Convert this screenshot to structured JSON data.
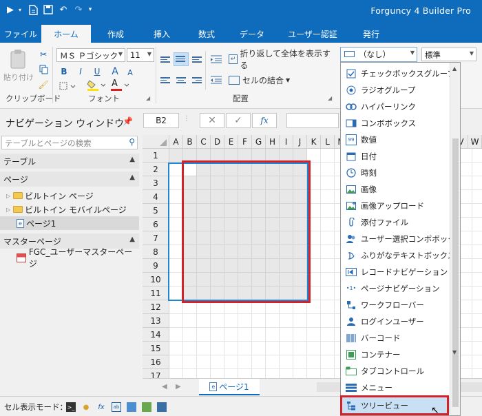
{
  "title_bar": {
    "app_title": "Forguncy 4 Builder Pro"
  },
  "ribbon_tabs": [
    "ファイル",
    "ホーム",
    "作成",
    "挿入",
    "数式",
    "データ",
    "ユーザー認証",
    "発行"
  ],
  "active_tab": "ホーム",
  "ribbon": {
    "paste_label": "貼り付け",
    "clipboard_group": "クリップボード",
    "font_group": "フォント",
    "alignment_group": "配置",
    "font_name": "ＭＳ Ｐゴシック",
    "font_size": "11",
    "wrap_text": "折り返して全体を表示する",
    "merge_cells": "セルの結合",
    "cell_type_combo": "（なし）",
    "style_combo": "標準",
    "bold": "B",
    "italic": "I",
    "underline": "U",
    "grow_font": "A",
    "shrink_font": "A",
    "font_color_letter": "A"
  },
  "navigation": {
    "title": "ナビゲーション ウィンドウ",
    "search_placeholder": "テーブルとページの検索",
    "sections": {
      "tables": "テーブル",
      "pages": "ページ",
      "master_pages": "マスターページ"
    },
    "page_items": [
      "ビルトイン ページ",
      "ビルトイン モバイルページ",
      "ページ1"
    ],
    "master_items": [
      "FGC_ユーザーマスターページ"
    ]
  },
  "formula_bar": {
    "name_box": "B2",
    "cancel": "✕",
    "confirm": "✓",
    "fx": "fx"
  },
  "grid": {
    "columns": [
      "A",
      "B",
      "C",
      "D",
      "E",
      "F",
      "G",
      "H",
      "I",
      "J",
      "K",
      "L",
      "M"
    ],
    "right_columns": [
      "V",
      "W"
    ],
    "rows": [
      "1",
      "2",
      "3",
      "4",
      "5",
      "6",
      "7",
      "8",
      "9",
      "10",
      "11",
      "12",
      "13",
      "14",
      "15",
      "16",
      "17"
    ]
  },
  "sheet_tab": "ページ1",
  "status_bar": {
    "label": "セル表示モード："
  },
  "cell_type_list": [
    {
      "label": "チェックボックスグループ",
      "icon": "checkbox-icon"
    },
    {
      "label": "ラジオグループ",
      "icon": "radio-icon"
    },
    {
      "label": "ハイパーリンク",
      "icon": "link-icon"
    },
    {
      "label": "コンボボックス",
      "icon": "combobox-icon"
    },
    {
      "label": "数値",
      "icon": "number-icon"
    },
    {
      "label": "日付",
      "icon": "calendar-icon"
    },
    {
      "label": "時刻",
      "icon": "clock-icon"
    },
    {
      "label": "画像",
      "icon": "image-icon"
    },
    {
      "label": "画像アップロード",
      "icon": "image-upload-icon"
    },
    {
      "label": "添付ファイル",
      "icon": "paperclip-icon"
    },
    {
      "label": "ユーザー選択コンボボックス",
      "icon": "users-icon"
    },
    {
      "label": "ふりがなテキストボックス",
      "icon": "furigana-icon"
    },
    {
      "label": "レコードナビゲーション",
      "icon": "record-nav-icon"
    },
    {
      "label": "ページナビゲーション",
      "icon": "page-nav-icon"
    },
    {
      "label": "ワークフローバー",
      "icon": "workflow-icon"
    },
    {
      "label": "ログインユーザー",
      "icon": "user-icon"
    },
    {
      "label": "バーコード",
      "icon": "barcode-icon"
    },
    {
      "label": "コンテナー",
      "icon": "container-icon"
    },
    {
      "label": "タブコントロール",
      "icon": "tab-control-icon"
    },
    {
      "label": "メニュー",
      "icon": "menu-icon"
    },
    {
      "label": "ツリービュー",
      "icon": "treeview-icon"
    }
  ],
  "highlighted_item": "ツリービュー",
  "colors": {
    "accent": "#0f6cbd",
    "highlight_box": "#d2232a",
    "selection": "#c9dff3"
  }
}
